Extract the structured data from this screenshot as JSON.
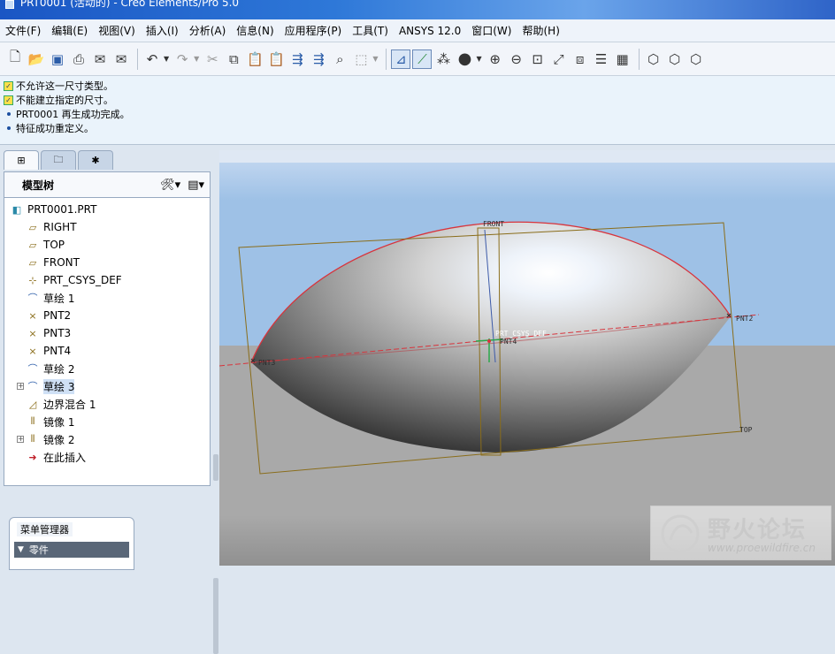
{
  "window": {
    "title": "PRT0001 (活动的) - Creo Elements/Pro 5.0"
  },
  "menubar": {
    "items": [
      "文件(F)",
      "编辑(E)",
      "视图(V)",
      "插入(I)",
      "分析(A)",
      "信息(N)",
      "应用程序(P)",
      "工具(T)",
      "ANSYS 12.0",
      "窗口(W)",
      "帮助(H)"
    ]
  },
  "toolbar": {
    "icons": [
      "new-file-icon",
      "open-folder-icon",
      "save-icon",
      "print-icon",
      "send-mail-icon",
      "mail-back-icon",
      "undo-icon",
      "redo-icon",
      "cut-icon",
      "copy-icon",
      "paste-icon",
      "paste-special-icon",
      "regenerate-icon",
      "manager-icon",
      "find-icon",
      "select-box-icon",
      "sketch-view-icon",
      "sketch-display-icon",
      "point-display-icon",
      "shaded-sphere-icon",
      "zoom-in-icon",
      "zoom-out-icon",
      "refit-icon",
      "reorient-icon",
      "saved-views-icon",
      "layers-icon",
      "model-display-icon",
      "wireframe-icon",
      "hidden-line-icon"
    ]
  },
  "messages": [
    {
      "type": "warning",
      "text": "不允许这一尺寸类型。"
    },
    {
      "type": "warning",
      "text": "不能建立指定的尺寸。"
    },
    {
      "type": "info",
      "text": "PRT0001 再生成功完成。"
    },
    {
      "type": "info",
      "text": "特征成功重定义。"
    }
  ],
  "model_tree": {
    "title": "模型树",
    "root": "PRT0001.PRT",
    "nodes": [
      {
        "label": "RIGHT",
        "icon": "datum-plane-icon"
      },
      {
        "label": "TOP",
        "icon": "datum-plane-icon"
      },
      {
        "label": "FRONT",
        "icon": "datum-plane-icon"
      },
      {
        "label": "PRT_CSYS_DEF",
        "icon": "csys-icon"
      },
      {
        "label": "草绘 1",
        "icon": "sketch-icon"
      },
      {
        "label": "PNT2",
        "icon": "datum-point-icon"
      },
      {
        "label": "PNT3",
        "icon": "datum-point-icon"
      },
      {
        "label": "PNT4",
        "icon": "datum-point-icon"
      },
      {
        "label": "草绘 2",
        "icon": "sketch-icon"
      },
      {
        "label": "草绘 3",
        "icon": "sketch-icon",
        "expandable": true,
        "selected": true
      },
      {
        "label": "边界混合 1",
        "icon": "boundary-blend-icon"
      },
      {
        "label": "镜像 1",
        "icon": "mirror-icon"
      },
      {
        "label": "镜像 2",
        "icon": "mirror-icon",
        "expandable": true
      },
      {
        "label": "在此插入",
        "icon": "insert-here-arrow-icon"
      }
    ]
  },
  "menu_manager": {
    "title": "菜单管理器",
    "section": "零件"
  },
  "viewport": {
    "labels": {
      "front": "FRONT",
      "top": "TOP",
      "csys": "PRT_CSYS_DEF",
      "pnt4": "PNT4",
      "pnt3": "PNT3",
      "pnt2": "PNT2"
    }
  },
  "watermark": {
    "text": "野火论坛",
    "url": "www.proewildfire.cn"
  }
}
